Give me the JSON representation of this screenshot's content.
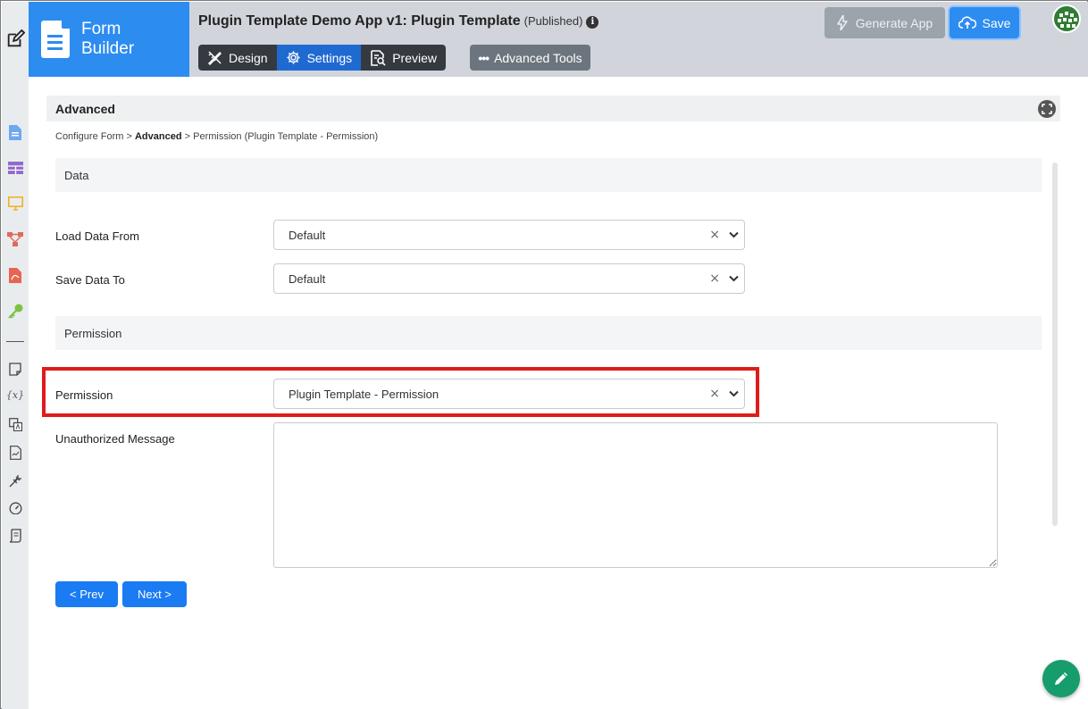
{
  "brand": {
    "line1": "Form",
    "line2": "Builder"
  },
  "header": {
    "title": "Plugin Template Demo App v1: Plugin Template",
    "status": "(Published)",
    "info_glyph": "i",
    "tabs": [
      {
        "label": "Design",
        "icon": "pencil-ruler-icon"
      },
      {
        "label": "Settings",
        "icon": "gear-icon"
      },
      {
        "label": "Preview",
        "icon": "preview-icon"
      }
    ],
    "advanced_tools": "Advanced Tools",
    "generate_app": "Generate App",
    "save": "Save"
  },
  "panel": {
    "title": "Advanced",
    "breadcrumb": {
      "root": "Configure Form",
      "sep": ">",
      "current": "Advanced",
      "leaf": "Permission (Plugin Template - Permission)"
    }
  },
  "form": {
    "data_section": "Data",
    "load_data_from": {
      "label": "Load Data From",
      "value": "Default"
    },
    "save_data_to": {
      "label": "Save Data To",
      "value": "Default"
    },
    "permission_section": "Permission",
    "permission": {
      "label": "Permission",
      "value": "Plugin Template - Permission"
    },
    "unauthorized_message": {
      "label": "Unauthorized Message",
      "value": ""
    },
    "clear_glyph": "×"
  },
  "nav": {
    "prev": "< Prev",
    "next": "Next >"
  },
  "colors": {
    "brand": "#2d8cf0",
    "active_tab": "#1f6ad1",
    "highlight": "#e01b1b",
    "fab": "#179c6c"
  },
  "rail_icons": [
    "edit-icon",
    "form-icon",
    "table-icon",
    "ui-icon",
    "process-icon",
    "pdf-icon",
    "key-icon",
    "note-icon",
    "variable-icon",
    "translate-icon",
    "report-icon",
    "plugin-icon",
    "performance-icon",
    "script-icon"
  ]
}
